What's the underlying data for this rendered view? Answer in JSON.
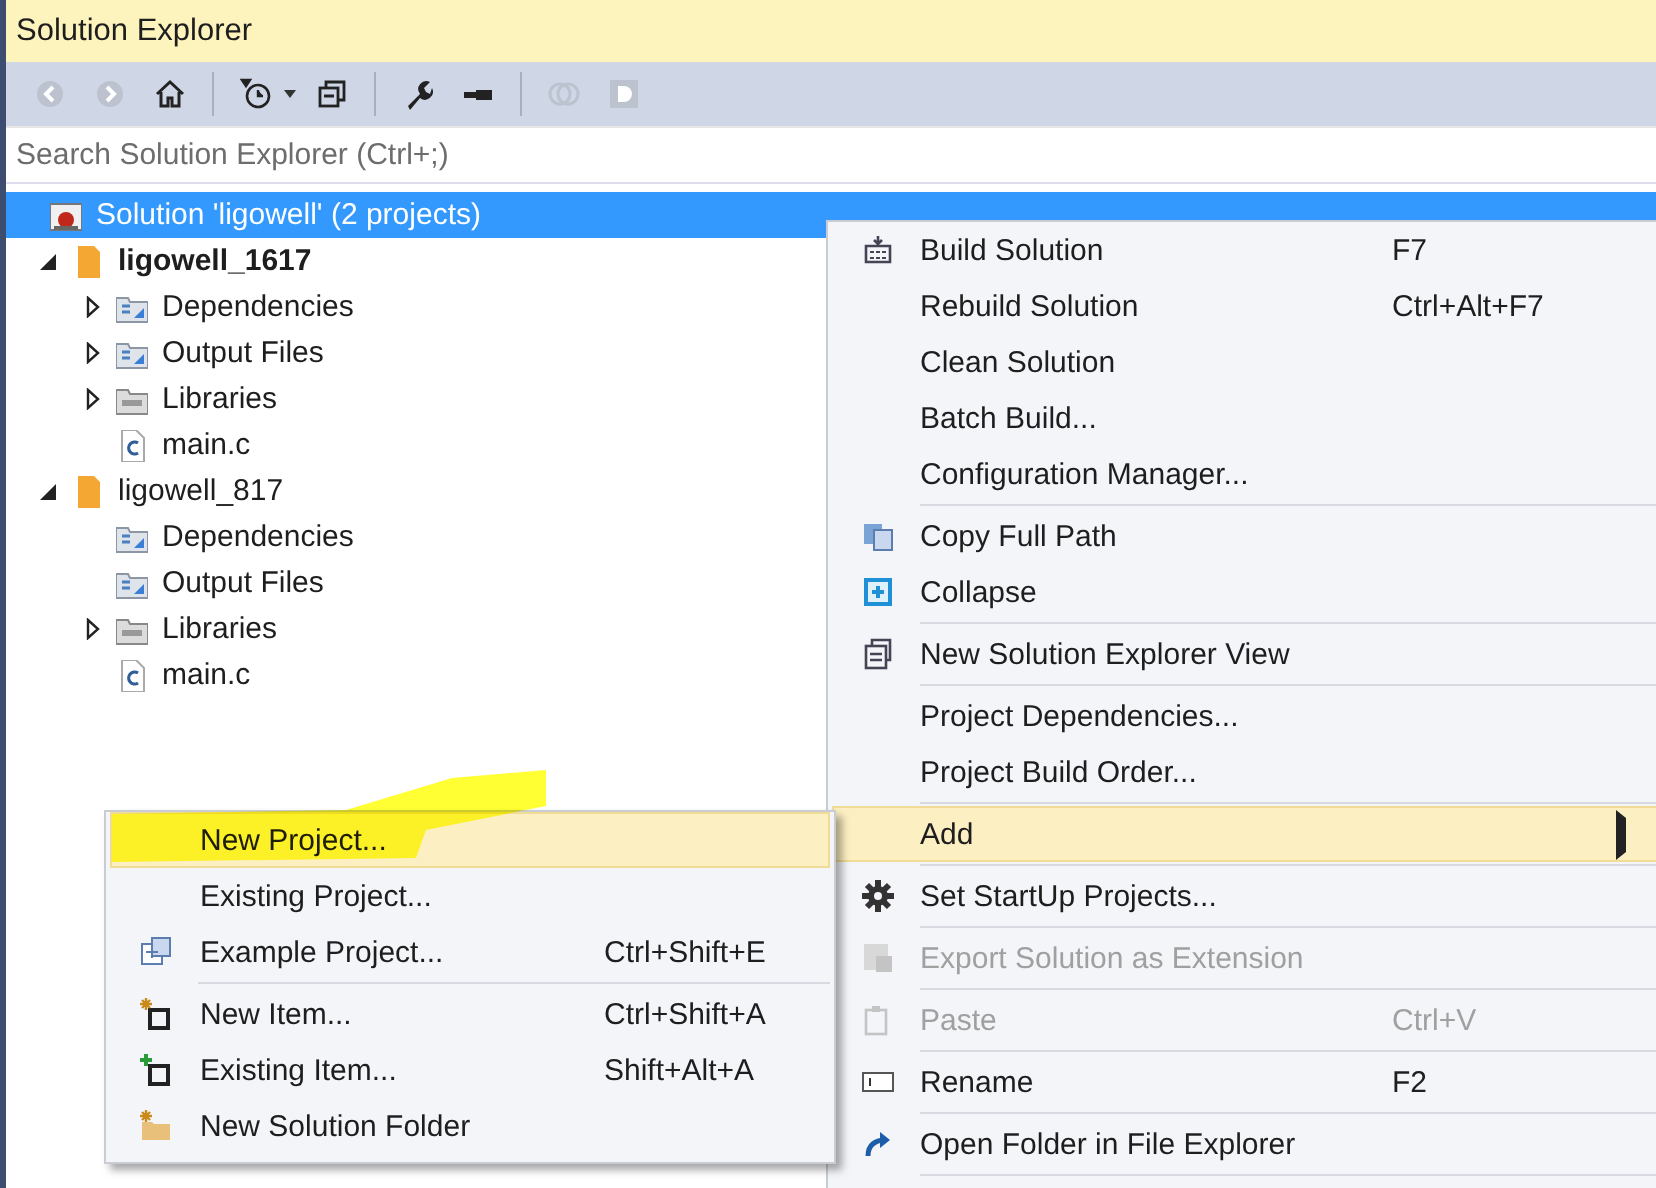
{
  "window": {
    "title": "Solution Explorer"
  },
  "toolbar": {
    "buttons": [
      {
        "disabled": true
      },
      {
        "disabled": true
      },
      {
        "disabled": false
      },
      {
        "disabled": false
      },
      {
        "disabled": false
      },
      {
        "disabled": false
      },
      {
        "disabled": false
      },
      {
        "disabled": true
      },
      {
        "disabled": true
      }
    ]
  },
  "search": {
    "placeholder": "Search Solution Explorer (Ctrl+;)"
  },
  "tree": [
    {
      "kind": "solution",
      "label": "Solution 'ligowell' (2 projects)",
      "selected": true,
      "children": [
        {
          "kind": "project",
          "label": "ligowell_1617",
          "startup": true,
          "expanded": true,
          "selected": false,
          "children": [
            {
              "kind": "filter",
              "label": "Dependencies",
              "expanded": false,
              "selected": false
            },
            {
              "kind": "filter",
              "label": "Output Files",
              "expanded": false,
              "selected": false
            },
            {
              "kind": "library",
              "label": "Libraries",
              "expanded": false,
              "selected": false
            },
            {
              "kind": "source",
              "label": "main.c",
              "selected": false
            }
          ]
        },
        {
          "kind": "project",
          "label": "ligowell_817",
          "startup": false,
          "expanded": true,
          "selected": false,
          "children": [
            {
              "kind": "filter",
              "label": "Dependencies",
              "selected": false
            },
            {
              "kind": "filter",
              "label": "Output Files",
              "selected": false
            },
            {
              "kind": "library",
              "label": "Libraries",
              "expanded": false,
              "selected": false
            },
            {
              "kind": "source",
              "label": "main.c",
              "selected": false
            }
          ]
        }
      ]
    }
  ],
  "context_menu": {
    "groups": [
      [
        {
          "label": "Build Solution",
          "shortcut": "F7",
          "disabled": false,
          "selected": false
        },
        {
          "label": "Rebuild Solution",
          "shortcut": "Ctrl+Alt+F7",
          "disabled": false,
          "selected": false
        },
        {
          "label": "Clean Solution",
          "disabled": false,
          "selected": false
        },
        {
          "label": "Batch Build...",
          "disabled": false,
          "selected": false
        },
        {
          "label": "Configuration Manager...",
          "disabled": false,
          "selected": false
        }
      ],
      [
        {
          "label": "Copy Full Path",
          "disabled": false,
          "selected": false
        },
        {
          "label": "Collapse",
          "disabled": false,
          "selected": false
        }
      ],
      [
        {
          "label": "New Solution Explorer View",
          "disabled": false,
          "selected": false
        }
      ],
      [
        {
          "label": "Project Dependencies...",
          "disabled": false,
          "selected": false
        },
        {
          "label": "Project Build Order...",
          "disabled": false,
          "selected": false
        }
      ],
      [
        {
          "label": "Add",
          "submenu": true,
          "disabled": false,
          "selected": true
        }
      ],
      [
        {
          "label": "Set StartUp Projects...",
          "disabled": false,
          "selected": false
        }
      ],
      [
        {
          "label": "Export Solution as Extension",
          "disabled": true,
          "selected": false
        }
      ],
      [
        {
          "label": "Paste",
          "shortcut": "Ctrl+V",
          "disabled": true,
          "selected": false
        }
      ],
      [
        {
          "label": "Rename",
          "shortcut": "F2",
          "disabled": false,
          "selected": false
        }
      ],
      [
        {
          "label": "Open Folder in File Explorer",
          "disabled": false,
          "selected": false
        }
      ]
    ]
  },
  "add_submenu": {
    "groups": [
      [
        {
          "label": "New Project...",
          "selected": true,
          "highlighter": true
        },
        {
          "label": "Existing Project...",
          "selected": false
        },
        {
          "label": "Example Project...",
          "shortcut": "Ctrl+Shift+E",
          "selected": false
        }
      ],
      [
        {
          "label": "New Item...",
          "shortcut": "Ctrl+Shift+A",
          "selected": false
        },
        {
          "label": "Existing Item...",
          "shortcut": "Shift+Alt+A",
          "selected": false
        },
        {
          "label": "New Solution Folder",
          "selected": false
        }
      ]
    ]
  }
}
